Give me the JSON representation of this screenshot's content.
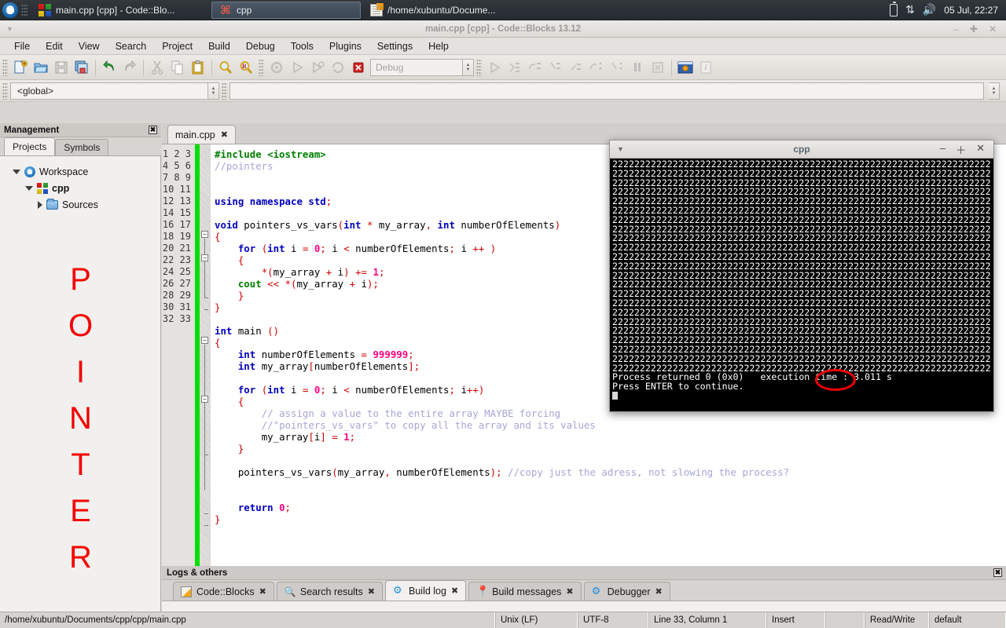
{
  "taskbar": {
    "start_icon": "xubuntu-mouse-icon",
    "windows": [
      {
        "icon": "codeblocks-icon",
        "label": "main.cpp [cpp] - Code::Blo..."
      },
      {
        "icon": "terminal-icon",
        "label": "cpp"
      },
      {
        "icon": "text-editor-icon",
        "label": "/home/xubuntu/Docume..."
      }
    ],
    "tray": {
      "battery": "battery-icon",
      "network": "network-updown-icon",
      "volume": "volume-icon"
    },
    "clock": "05 Jul, 22:27"
  },
  "window": {
    "title": "main.cpp [cpp] - Code::Blocks 13.12",
    "minimize": "–",
    "maximize": "✚",
    "close": "✕"
  },
  "menubar": [
    "File",
    "Edit",
    "View",
    "Search",
    "Project",
    "Build",
    "Debug",
    "Tools",
    "Plugins",
    "Settings",
    "Help"
  ],
  "toolbar": {
    "target_combo": "Debug",
    "scope_combo": "<global>",
    "icons": [
      "new-file-icon",
      "open-file-icon",
      "save-icon",
      "save-all-icon",
      "undo-icon",
      "redo-icon",
      "cut-icon",
      "copy-icon",
      "paste-icon",
      "find-icon",
      "replace-icon",
      "build-icon",
      "run-icon",
      "build-and-run-icon",
      "rebuild-icon",
      "abort-icon",
      "debug-continue-icon",
      "debug-next-line-icon",
      "debug-step-into-icon",
      "debug-step-out-icon",
      "debug-next-instruction-icon",
      "debug-step-into-instruction-icon",
      "debug-various-icon",
      "break-debugger-icon",
      "stop-debugger-icon",
      "debugging-windows-icon",
      "debug-info-icon"
    ]
  },
  "management": {
    "title": "Management",
    "close_glyph": "✖",
    "tabs": [
      {
        "label": "Projects",
        "active": true
      },
      {
        "label": "Symbols",
        "active": false
      }
    ],
    "tree": [
      {
        "label": "Workspace",
        "icon": "workspace-icon",
        "expander": "down",
        "indent": 0
      },
      {
        "label": "cpp",
        "icon": "project-icon",
        "expander": "down",
        "indent": 1,
        "bold": true
      },
      {
        "label": "Sources",
        "icon": "folder-icon",
        "expander": "right",
        "indent": 2
      }
    ],
    "annotation_word": [
      "P",
      "O",
      "I",
      "N",
      "T",
      "E",
      "R"
    ],
    "annotation_color": "#f40000"
  },
  "editor": {
    "tab": {
      "label": "main.cpp",
      "close_glyph": "✖"
    },
    "line_count": 33,
    "lines": [
      {
        "n": 1,
        "tokens": [
          {
            "t": "#include <iostream>",
            "c": "pp"
          }
        ]
      },
      {
        "n": 2,
        "tokens": [
          {
            "t": "//pointers",
            "c": "cm"
          }
        ]
      },
      {
        "n": 3,
        "tokens": []
      },
      {
        "n": 4,
        "tokens": []
      },
      {
        "n": 5,
        "tokens": [
          {
            "t": "using",
            "c": "k"
          },
          {
            "t": " ",
            "c": "id"
          },
          {
            "t": "namespace",
            "c": "k"
          },
          {
            "t": " ",
            "c": "id"
          },
          {
            "t": "std",
            "c": "k"
          },
          {
            "t": ";",
            "c": "op"
          }
        ]
      },
      {
        "n": 6,
        "tokens": []
      },
      {
        "n": 7,
        "tokens": [
          {
            "t": "void",
            "c": "k"
          },
          {
            "t": " pointers_vs_vars",
            "c": "id"
          },
          {
            "t": "(",
            "c": "op"
          },
          {
            "t": "int",
            "c": "k"
          },
          {
            "t": " ",
            "c": "id"
          },
          {
            "t": "*",
            "c": "op"
          },
          {
            "t": " my_array",
            "c": "id"
          },
          {
            "t": ",",
            "c": "op"
          },
          {
            "t": " ",
            "c": "id"
          },
          {
            "t": "int",
            "c": "k"
          },
          {
            "t": " numberOfElements",
            "c": "id"
          },
          {
            "t": ")",
            "c": "op"
          }
        ]
      },
      {
        "n": 8,
        "tokens": [
          {
            "t": "{",
            "c": "op"
          }
        ]
      },
      {
        "n": 9,
        "tokens": [
          {
            "t": "    ",
            "c": "id"
          },
          {
            "t": "for",
            "c": "k"
          },
          {
            "t": " ",
            "c": "id"
          },
          {
            "t": "(",
            "c": "op"
          },
          {
            "t": "int",
            "c": "k"
          },
          {
            "t": " i ",
            "c": "id"
          },
          {
            "t": "=",
            "c": "op"
          },
          {
            "t": " ",
            "c": "id"
          },
          {
            "t": "0",
            "c": "nu"
          },
          {
            "t": ";",
            "c": "op"
          },
          {
            "t": " i ",
            "c": "id"
          },
          {
            "t": "<",
            "c": "op"
          },
          {
            "t": " numberOfElements",
            "c": "id"
          },
          {
            "t": ";",
            "c": "op"
          },
          {
            "t": " i ",
            "c": "id"
          },
          {
            "t": "++",
            "c": "op"
          },
          {
            "t": " ",
            "c": "id"
          },
          {
            "t": ")",
            "c": "op"
          }
        ]
      },
      {
        "n": 10,
        "tokens": [
          {
            "t": "    ",
            "c": "id"
          },
          {
            "t": "{",
            "c": "op"
          }
        ]
      },
      {
        "n": 11,
        "tokens": [
          {
            "t": "        ",
            "c": "id"
          },
          {
            "t": "*(",
            "c": "op"
          },
          {
            "t": "my_array ",
            "c": "id"
          },
          {
            "t": "+",
            "c": "op"
          },
          {
            "t": " i",
            "c": "id"
          },
          {
            "t": ")",
            "c": "op"
          },
          {
            "t": " ",
            "c": "id"
          },
          {
            "t": "+=",
            "c": "op"
          },
          {
            "t": " ",
            "c": "id"
          },
          {
            "t": "1",
            "c": "nu"
          },
          {
            "t": ";",
            "c": "op"
          }
        ]
      },
      {
        "n": 12,
        "tokens": [
          {
            "t": "    ",
            "c": "id"
          },
          {
            "t": "cout",
            "c": "st"
          },
          {
            "t": " ",
            "c": "id"
          },
          {
            "t": "<<",
            "c": "op"
          },
          {
            "t": " ",
            "c": "id"
          },
          {
            "t": "*(",
            "c": "op"
          },
          {
            "t": "my_array ",
            "c": "id"
          },
          {
            "t": "+",
            "c": "op"
          },
          {
            "t": " i",
            "c": "id"
          },
          {
            "t": ");",
            "c": "op"
          }
        ]
      },
      {
        "n": 13,
        "tokens": [
          {
            "t": "    ",
            "c": "id"
          },
          {
            "t": "}",
            "c": "op"
          }
        ]
      },
      {
        "n": 14,
        "tokens": [
          {
            "t": "}",
            "c": "op"
          }
        ]
      },
      {
        "n": 15,
        "tokens": []
      },
      {
        "n": 16,
        "tokens": [
          {
            "t": "int",
            "c": "k"
          },
          {
            "t": " main ",
            "c": "id"
          },
          {
            "t": "()",
            "c": "op"
          }
        ]
      },
      {
        "n": 17,
        "tokens": [
          {
            "t": "{",
            "c": "op"
          }
        ]
      },
      {
        "n": 18,
        "tokens": [
          {
            "t": "    ",
            "c": "id"
          },
          {
            "t": "int",
            "c": "k"
          },
          {
            "t": " numberOfElements ",
            "c": "id"
          },
          {
            "t": "=",
            "c": "op"
          },
          {
            "t": " ",
            "c": "id"
          },
          {
            "t": "999999",
            "c": "nu"
          },
          {
            "t": ";",
            "c": "op"
          }
        ]
      },
      {
        "n": 19,
        "tokens": [
          {
            "t": "    ",
            "c": "id"
          },
          {
            "t": "int",
            "c": "k"
          },
          {
            "t": " my_array",
            "c": "id"
          },
          {
            "t": "[",
            "c": "op"
          },
          {
            "t": "numberOfElements",
            "c": "id"
          },
          {
            "t": "];",
            "c": "op"
          }
        ]
      },
      {
        "n": 20,
        "tokens": []
      },
      {
        "n": 21,
        "tokens": [
          {
            "t": "    ",
            "c": "id"
          },
          {
            "t": "for",
            "c": "k"
          },
          {
            "t": " ",
            "c": "id"
          },
          {
            "t": "(",
            "c": "op"
          },
          {
            "t": "int",
            "c": "k"
          },
          {
            "t": " i ",
            "c": "id"
          },
          {
            "t": "=",
            "c": "op"
          },
          {
            "t": " ",
            "c": "id"
          },
          {
            "t": "0",
            "c": "nu"
          },
          {
            "t": ";",
            "c": "op"
          },
          {
            "t": " i ",
            "c": "id"
          },
          {
            "t": "<",
            "c": "op"
          },
          {
            "t": " numberOfElements",
            "c": "id"
          },
          {
            "t": ";",
            "c": "op"
          },
          {
            "t": " i",
            "c": "id"
          },
          {
            "t": "++)",
            "c": "op"
          }
        ]
      },
      {
        "n": 22,
        "tokens": [
          {
            "t": "    ",
            "c": "id"
          },
          {
            "t": "{",
            "c": "op"
          }
        ]
      },
      {
        "n": 23,
        "tokens": [
          {
            "t": "        ",
            "c": "id"
          },
          {
            "t": "// assign a value to the entire array MAYBE forcing",
            "c": "cm"
          }
        ]
      },
      {
        "n": 24,
        "tokens": [
          {
            "t": "        ",
            "c": "id"
          },
          {
            "t": "//\"pointers_vs_vars\" to copy all the array and its values",
            "c": "cm"
          }
        ]
      },
      {
        "n": 25,
        "tokens": [
          {
            "t": "        ",
            "c": "id"
          },
          {
            "t": "my_array",
            "c": "id"
          },
          {
            "t": "[",
            "c": "op"
          },
          {
            "t": "i",
            "c": "id"
          },
          {
            "t": "]",
            "c": "op"
          },
          {
            "t": " ",
            "c": "id"
          },
          {
            "t": "=",
            "c": "op"
          },
          {
            "t": " ",
            "c": "id"
          },
          {
            "t": "1",
            "c": "nu"
          },
          {
            "t": ";",
            "c": "op"
          }
        ]
      },
      {
        "n": 26,
        "tokens": [
          {
            "t": "    ",
            "c": "id"
          },
          {
            "t": "}",
            "c": "op"
          }
        ]
      },
      {
        "n": 27,
        "tokens": []
      },
      {
        "n": 28,
        "tokens": [
          {
            "t": "    ",
            "c": "id"
          },
          {
            "t": "pointers_vs_vars",
            "c": "id"
          },
          {
            "t": "(",
            "c": "op"
          },
          {
            "t": "my_array",
            "c": "id"
          },
          {
            "t": ",",
            "c": "op"
          },
          {
            "t": " numberOfElements",
            "c": "id"
          },
          {
            "t": ");",
            "c": "op"
          },
          {
            "t": " ",
            "c": "id"
          },
          {
            "t": "//copy just the adress, not slowing the process?",
            "c": "cm"
          }
        ]
      },
      {
        "n": 29,
        "tokens": []
      },
      {
        "n": 30,
        "tokens": []
      },
      {
        "n": 31,
        "tokens": [
          {
            "t": "    ",
            "c": "id"
          },
          {
            "t": "return",
            "c": "k"
          },
          {
            "t": " ",
            "c": "id"
          },
          {
            "t": "0",
            "c": "nu"
          },
          {
            "t": ";",
            "c": "op"
          }
        ]
      },
      {
        "n": 32,
        "tokens": [
          {
            "t": "}",
            "c": "op"
          }
        ]
      },
      {
        "n": 33,
        "tokens": []
      }
    ]
  },
  "logs": {
    "title": "Logs & others",
    "close_glyph": "✖",
    "tabs": [
      {
        "label": "Code::Blocks",
        "icon": "pencil-icon",
        "active": false,
        "close_glyph": "✖"
      },
      {
        "label": "Search results",
        "icon": "search-icon",
        "active": false,
        "close_glyph": "✖"
      },
      {
        "label": "Build log",
        "icon": "gear-icon",
        "active": true,
        "close_glyph": "✖"
      },
      {
        "label": "Build messages",
        "icon": "pin-icon",
        "active": false,
        "close_glyph": "✖"
      },
      {
        "label": "Debugger",
        "icon": "gear-icon",
        "active": false,
        "close_glyph": "✖"
      }
    ]
  },
  "statusbar": [
    "/home/xubuntu/Documents/cpp/cpp/main.cpp",
    "Unix (LF)",
    "UTF-8",
    "Line 33, Column 1",
    "Insert",
    "",
    "Read/Write",
    "default"
  ],
  "terminal": {
    "title": "cpp",
    "minimize": "–",
    "maximize": "＋",
    "close": "✕",
    "fill_char": "2",
    "fill_rows": 23,
    "fill_cols": 82,
    "output_lines": [
      "Process returned 0 (0x0)   execution time : 3.011 s",
      "Press ENTER to continue."
    ],
    "highlighted_value": "3.011 s",
    "highlight_color": "#ee0000"
  }
}
